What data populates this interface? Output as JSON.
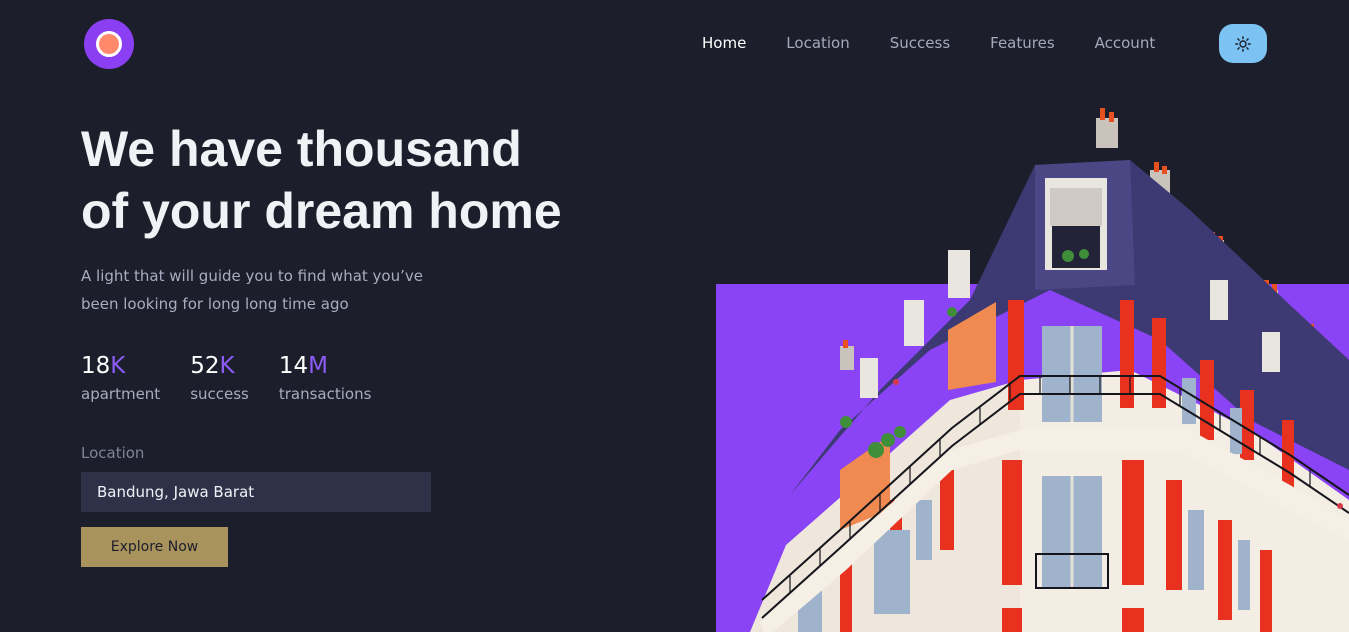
{
  "nav": {
    "items": [
      "Home",
      "Location",
      "Success",
      "Features",
      "Account"
    ],
    "active": "Home"
  },
  "theme_toggle": {
    "icon": "sun-icon"
  },
  "hero": {
    "headline_line1": "We have thousand",
    "headline_line2": "of your dream home",
    "subtext_line1": "A light that will guide you to find what you’ve",
    "subtext_line2": "been looking for long long time ago",
    "stats": [
      {
        "number": "18",
        "unit": "K",
        "label": "apartment"
      },
      {
        "number": "52",
        "unit": "K",
        "label": "success"
      },
      {
        "number": "14",
        "unit": "M",
        "label": "transactions"
      }
    ]
  },
  "search": {
    "label": "Location",
    "value": "Bandung, Jawa Barat",
    "button": "Explore Now"
  },
  "colors": {
    "background": "#1c1e2b",
    "accent_purple": "#8b5cf6",
    "button_gold": "#a8935c",
    "input_bg": "#2e3249",
    "toggle_blue": "#7cc3f4"
  }
}
